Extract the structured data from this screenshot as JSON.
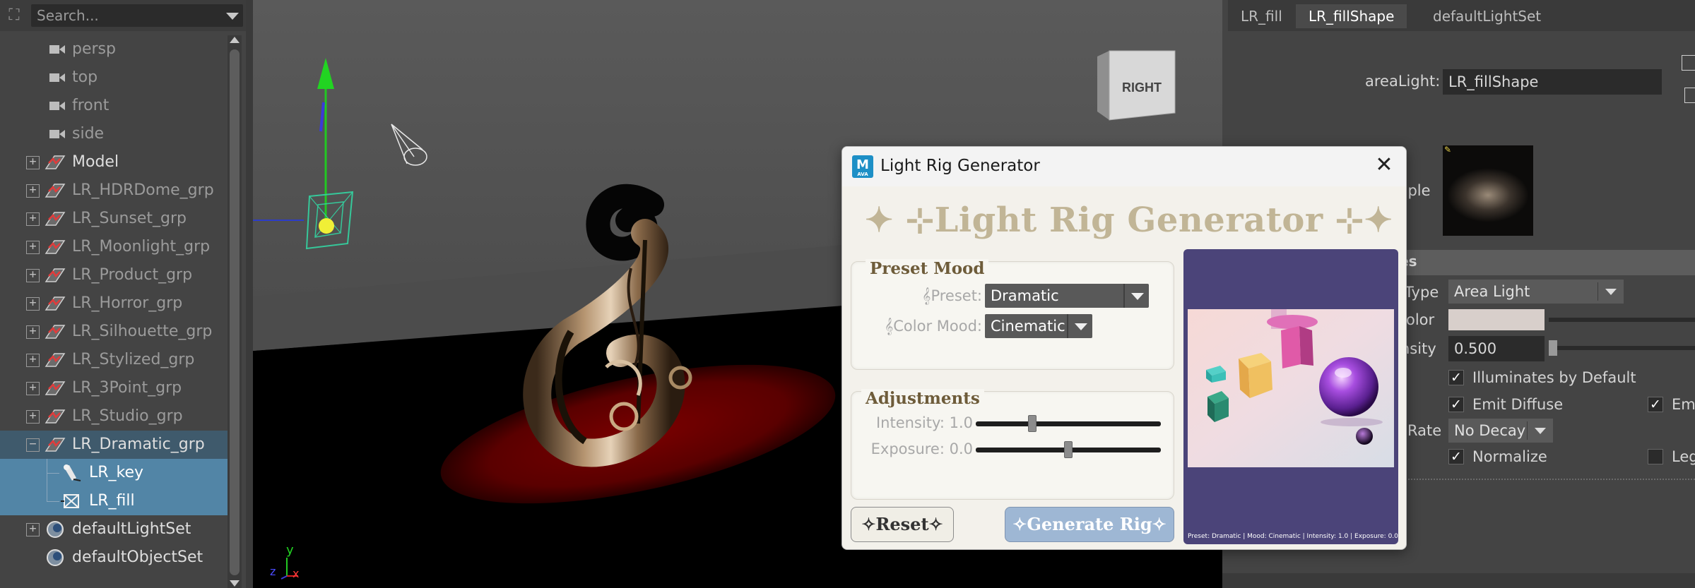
{
  "outliner": {
    "search_placeholder": "Search...",
    "items": [
      {
        "label": "persp",
        "kind": "camera"
      },
      {
        "label": "top",
        "kind": "camera"
      },
      {
        "label": "front",
        "kind": "camera"
      },
      {
        "label": "side",
        "kind": "camera"
      },
      {
        "label": "Model",
        "kind": "group"
      },
      {
        "label": "LR_HDRDome_grp",
        "kind": "group"
      },
      {
        "label": "LR_Sunset_grp",
        "kind": "group"
      },
      {
        "label": "LR_Moonlight_grp",
        "kind": "group"
      },
      {
        "label": "LR_Product_grp",
        "kind": "group"
      },
      {
        "label": "LR_Horror_grp",
        "kind": "group"
      },
      {
        "label": "LR_Silhouette_grp",
        "kind": "group"
      },
      {
        "label": "LR_Stylized_grp",
        "kind": "group"
      },
      {
        "label": "LR_3Point_grp",
        "kind": "group"
      },
      {
        "label": "LR_Studio_grp",
        "kind": "group"
      },
      {
        "label": "LR_Dramatic_grp",
        "kind": "group"
      },
      {
        "label": "LR_key",
        "kind": "spotlight"
      },
      {
        "label": "LR_fill",
        "kind": "arealight"
      },
      {
        "label": "defaultLightSet",
        "kind": "set"
      },
      {
        "label": "defaultObjectSet",
        "kind": "set"
      }
    ]
  },
  "viewport": {
    "view_cube_label": "RIGHT",
    "axis_y": "y",
    "axis_z": "z",
    "axis_x": "x"
  },
  "attribute_editor": {
    "tabs": [
      "LR_fill",
      "LR_fillShape",
      "defaultLightSet"
    ],
    "active_tab": "LR_fillShape",
    "node_type_label": "areaLight:",
    "node_name": "LR_fillShape",
    "sample_label": "mple",
    "section_title": "es",
    "type_label": "Type",
    "type_value": "Area Light",
    "color_label": "olor",
    "intensity_label": "nsity",
    "intensity_value": "0.500",
    "illuminates_label": "Illuminates by Default",
    "emit_diffuse_label": "Emit Diffuse",
    "emit_specular_label": "Em",
    "decay_label": "Rate",
    "decay_value": "No Decay",
    "normalize_label": "Normalize",
    "legacy_label": "Leg"
  },
  "dialog": {
    "window_title": "Light Rig Generator",
    "logo_letter": "M",
    "logo_sub": "AVA",
    "banner": "✦ ⊹Light Rig Generator ⊹✦",
    "preset_group_title": "Preset  Mood",
    "preset_label": "𝄞Preset:",
    "preset_value": "Dramatic",
    "color_mood_label": "𝄞Color Mood:",
    "color_mood_value": "Cinematic",
    "adjust_group_title": "Adjustments",
    "intensity_label": "Intensity: 1.0",
    "intensity_value": 1.0,
    "exposure_label": "Exposure: 0.0",
    "exposure_value": 0.0,
    "reset_label": "✧Reset✧",
    "generate_label": "✧Generate Rig✧",
    "preview_caption": "Preset: Dramatic | Mood: Cinematic | Intensity: 1.0 | Exposure: 0.0"
  },
  "colors": {
    "selection": "#5285a6",
    "banner_gold": "#c1b596",
    "generate_button": "#9eb7d4",
    "preview_bg": "#4b4479"
  }
}
